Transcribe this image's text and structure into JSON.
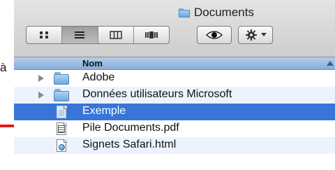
{
  "stray_text": "à",
  "window": {
    "title": "Documents"
  },
  "toolbar": {
    "view_modes": [
      {
        "name": "icon-view",
        "icon": "grid-icon",
        "active": false
      },
      {
        "name": "list-view",
        "icon": "list-icon",
        "active": true
      },
      {
        "name": "column-view",
        "icon": "columns-icon",
        "active": false
      },
      {
        "name": "coverflow-view",
        "icon": "coverflow-icon",
        "active": false
      }
    ],
    "quicklook_icon": "eye-icon",
    "action_icon": "gear-icon"
  },
  "list": {
    "column_header": "Nom",
    "sort_indicator": "sort-ascending-icon",
    "rows": [
      {
        "name": "Adobe",
        "kind": "folder",
        "selected": false
      },
      {
        "name": "Données utilisateurs Microsoft",
        "kind": "folder",
        "selected": false
      },
      {
        "name": "Exemple",
        "kind": "document",
        "selected": true
      },
      {
        "name": "Pile Documents.pdf",
        "kind": "pdf",
        "selected": false
      },
      {
        "name": "Signets Safari.html",
        "kind": "html",
        "selected": false
      }
    ]
  },
  "colors": {
    "selection": "#3875d7",
    "arrow": "#e11b1b",
    "header": "#a5c3e8",
    "alternate_row": "#edf3fe"
  },
  "annotation": {
    "icon": "red-arrow-icon"
  }
}
